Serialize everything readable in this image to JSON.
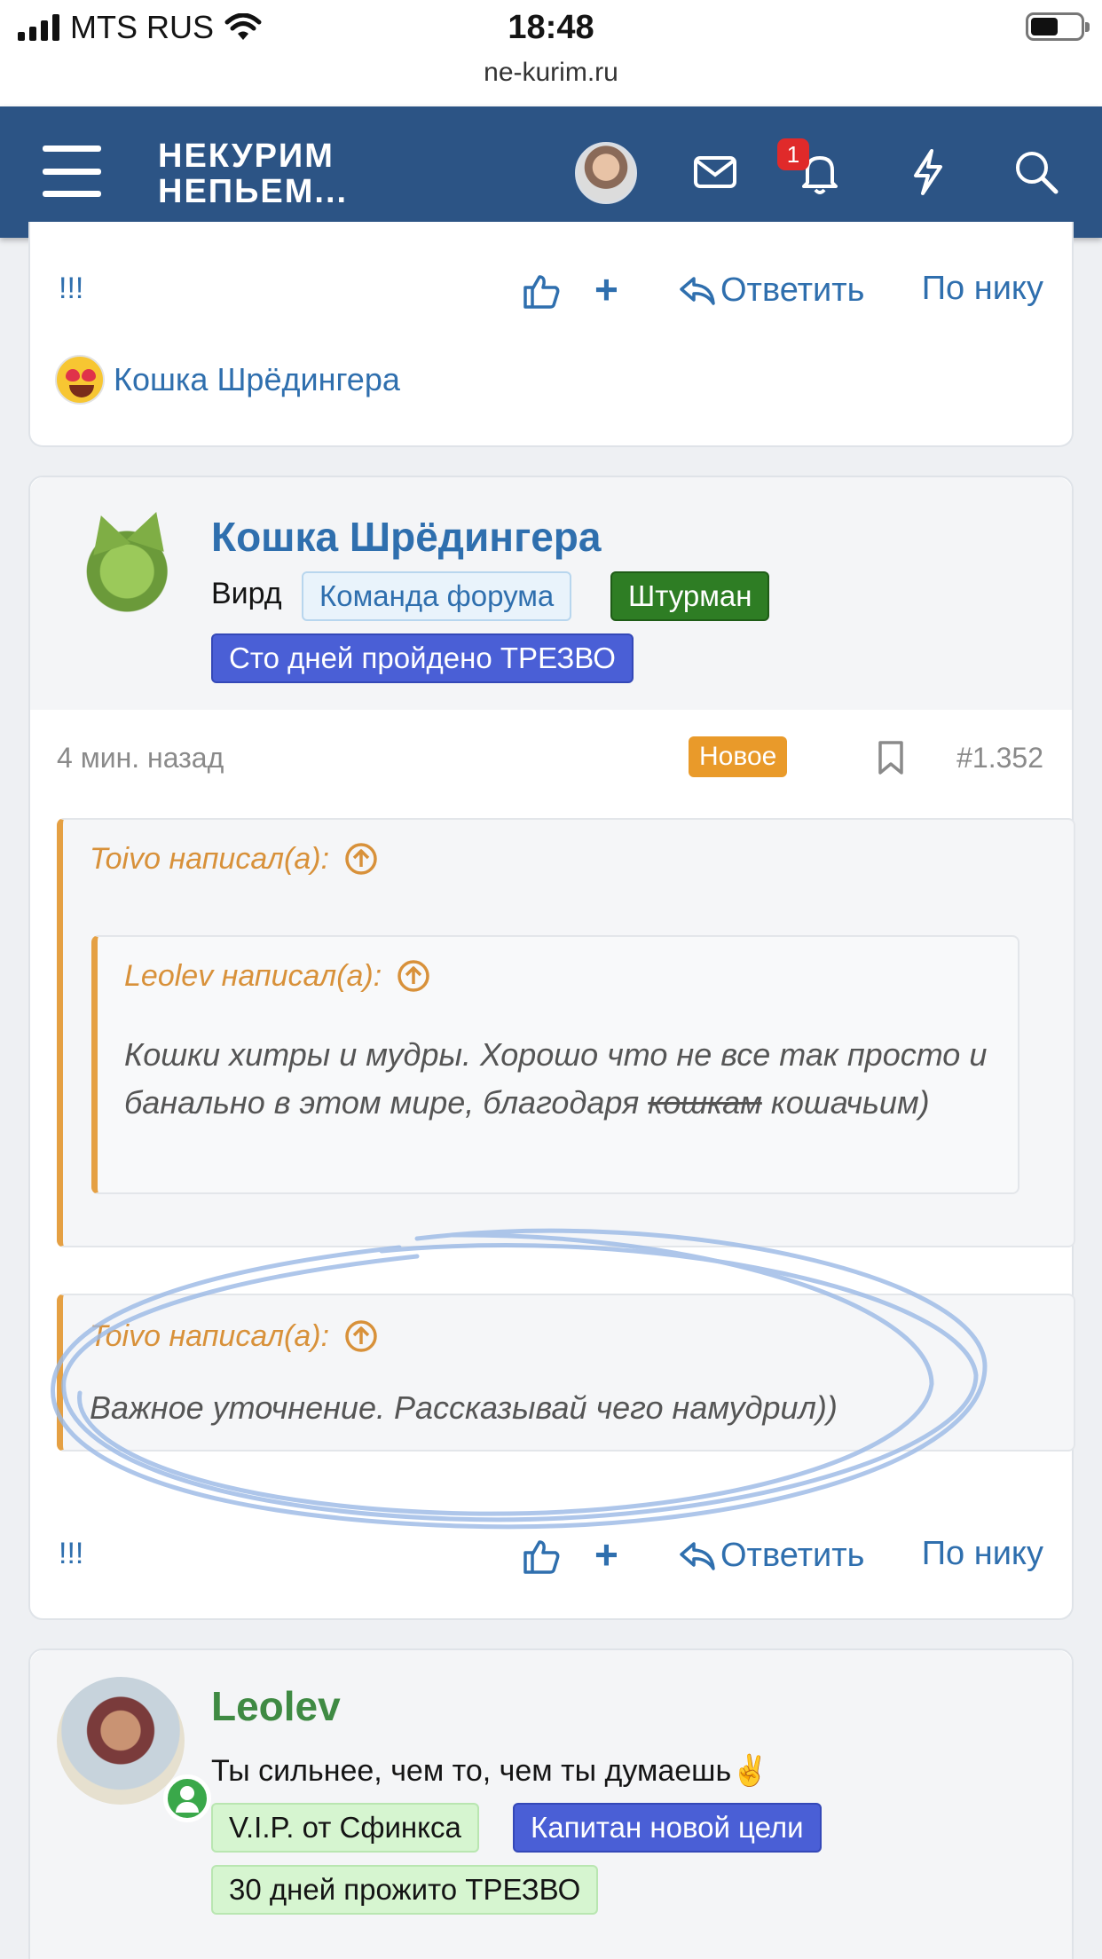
{
  "status": {
    "carrier": "MTS RUS",
    "time": "18:48"
  },
  "browser": {
    "url": "ne-kurim.ru"
  },
  "header": {
    "logo_line1": "НЕКУРИМ",
    "logo_line2": "НЕПЬЕМ...",
    "alerts_count": "1",
    "brand_color": "#2c5485"
  },
  "prev_post": {
    "actions": {
      "exclaim": "!!!",
      "plus": "+",
      "reply": "Ответить",
      "by_nick": "По нику"
    },
    "reaction_user": "Кошка Шрёдингера"
  },
  "post": {
    "author": "Кошка Шрёдингера",
    "user_title": "Вирд",
    "badges": [
      "Команда форума",
      "Штурман",
      "Сто дней пройдено ТРЕЗВО"
    ],
    "time": "4 мин. назад",
    "new_label": "Новое",
    "number": "#1.352",
    "quote1": {
      "author": "Toivo написал(а):",
      "nested": {
        "author": "Leolev написал(а):",
        "text_before": "Кошки хитры и мудры. Хорошо что не все так просто и банально в этом мире, благодаря ",
        "text_struck": "кошкам",
        "text_after": " кошачьим)"
      }
    },
    "quote2": {
      "author": "Toivo написал(а):",
      "text": "Важное уточнение. Рассказывай чего намудрил))"
    },
    "actions": {
      "exclaim": "!!!",
      "plus": "+",
      "reply": "Ответить",
      "by_nick": "По нику"
    }
  },
  "next_post": {
    "author": "Leolev",
    "user_title": "Ты сильнее, чем то, чем ты думаешь✌️",
    "badges": [
      "V.I.P. от Сфинкса",
      "Капитан новой цели",
      "30 дней прожито ТРЕЗВО"
    ]
  }
}
